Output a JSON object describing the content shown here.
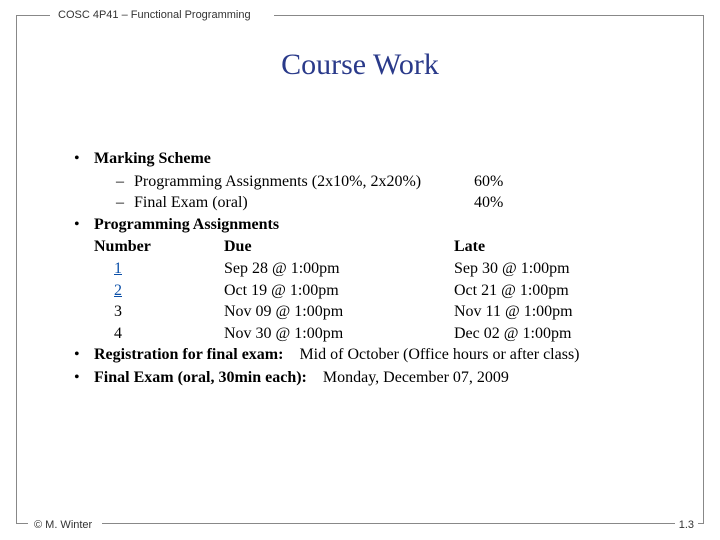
{
  "header": "COSC 4P41 – Functional Programming",
  "title": "Course Work",
  "marking": {
    "heading": "Marking Scheme",
    "items": [
      {
        "label": "Programming Assignments (2x10%, 2x20%)",
        "pct": "60%"
      },
      {
        "label": "Final Exam  (oral)",
        "pct": "40%"
      }
    ]
  },
  "assignments": {
    "heading": "Programming Assignments",
    "columns": {
      "num": "Number",
      "due": "Due",
      "late": "Late"
    },
    "rows": [
      {
        "num": "1",
        "link": true,
        "due": "Sep 28 @ 1:00pm",
        "late": "Sep 30 @ 1:00pm"
      },
      {
        "num": "2",
        "link": true,
        "due": "Oct 19 @ 1:00pm",
        "late": "Oct 21 @ 1:00pm"
      },
      {
        "num": "3",
        "link": false,
        "due": "Nov 09 @ 1:00pm",
        "late": "Nov 11 @ 1:00pm"
      },
      {
        "num": "4",
        "link": false,
        "due": "Nov 30 @ 1:00pm",
        "late": "Dec 02 @ 1:00pm"
      }
    ]
  },
  "registration": {
    "label": "Registration for final exam:",
    "value": "Mid of October (Office hours or after class)"
  },
  "final": {
    "label": "Final Exam (oral, 30min each):",
    "value": "Monday, December 07, 2009"
  },
  "footer": {
    "left": "© M. Winter",
    "right": "1.3"
  },
  "glyphs": {
    "bullet": "•",
    "dash": "–"
  }
}
